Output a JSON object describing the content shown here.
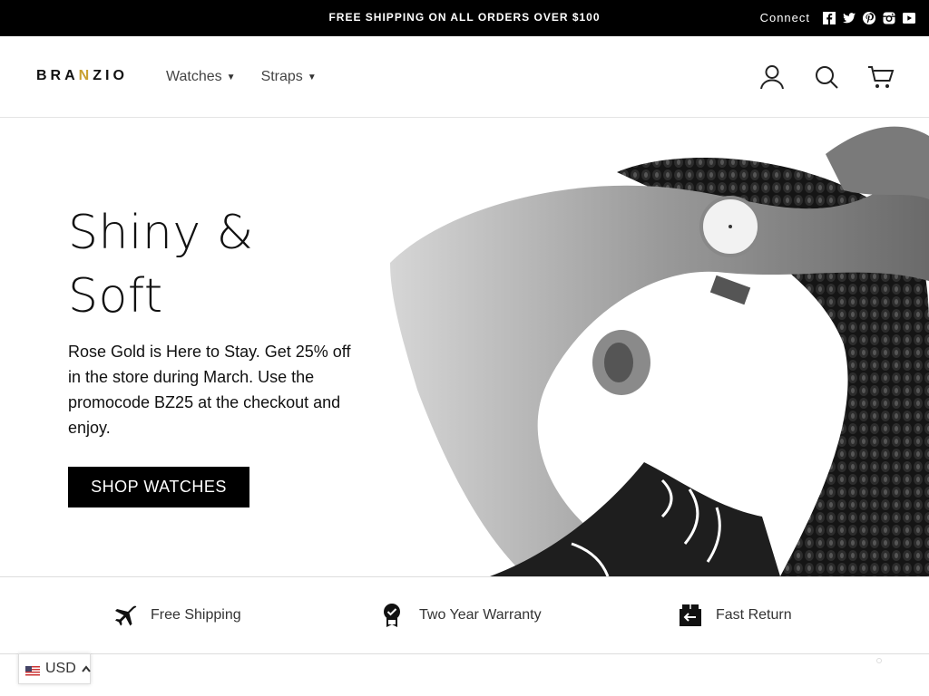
{
  "topbar": {
    "promo": "FREE SHIPPING ON ALL ORDERS OVER $100",
    "connect_label": "Connect",
    "social_icons": [
      "facebook-icon",
      "twitter-icon",
      "pinterest-icon",
      "instagram-icon",
      "youtube-icon"
    ]
  },
  "header": {
    "logo_before": "BRA",
    "logo_accent": "N",
    "logo_after": "ZIO",
    "nav": [
      {
        "label": "Watches"
      },
      {
        "label": "Straps"
      }
    ],
    "icons": [
      "account-icon",
      "search-icon",
      "cart-icon"
    ]
  },
  "hero": {
    "title_line1": "Shiny &",
    "title_line2": "Soft",
    "subtitle": "Rose Gold is Here to Stay. Get 25% off in the store during March. Use the promocode BZ25 at the checkout and enjoy.",
    "cta_label": "SHOP WATCHES"
  },
  "features": [
    {
      "label": "Free Shipping",
      "icon": "airplane-icon"
    },
    {
      "label": "Two Year Warranty",
      "icon": "warranty-badge-icon"
    },
    {
      "label": "Fast Return",
      "icon": "return-box-icon"
    }
  ],
  "currency": {
    "code": "USD",
    "icon": "us-flag-icon"
  },
  "colors": {
    "topbar_bg": "#000000",
    "button_bg": "#000000",
    "logo_accent": "#c8a030"
  }
}
